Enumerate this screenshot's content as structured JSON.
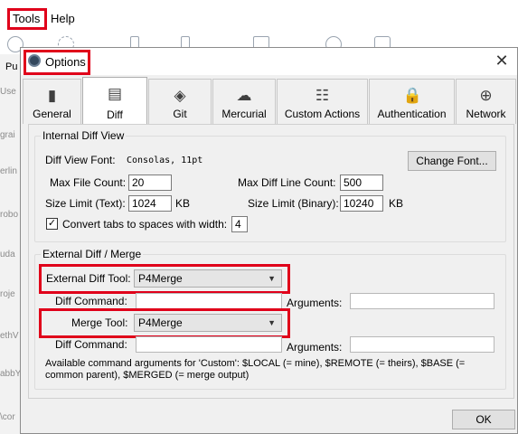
{
  "menubar": {
    "tools_label": "Tools",
    "help_label": "Help"
  },
  "sidebar": {
    "fragments": [
      "Pu",
      "Use",
      "grai",
      "erlin",
      "robo",
      "uda",
      "roje",
      "ethV",
      "abbY",
      "\\cor"
    ]
  },
  "dialog": {
    "title": "Options",
    "close_glyph": "✕",
    "tabs": [
      {
        "label": "General",
        "icon": "general-icon",
        "glyph": "▮"
      },
      {
        "label": "Diff",
        "icon": "diff-icon",
        "glyph": "▤"
      },
      {
        "label": "Git",
        "icon": "git-icon",
        "glyph": "◈"
      },
      {
        "label": "Mercurial",
        "icon": "mercurial-icon",
        "glyph": "☁"
      },
      {
        "label": "Custom Actions",
        "icon": "custom-actions-icon",
        "glyph": "☷"
      },
      {
        "label": "Authentication",
        "icon": "lock-icon",
        "glyph": "🔒"
      },
      {
        "label": "Network",
        "icon": "globe-icon",
        "glyph": "⊕"
      }
    ],
    "active_tab": "Diff",
    "internal": {
      "title": "Internal Diff View",
      "font_label": "Diff View Font:",
      "font_value": "Consolas, 11pt",
      "change_font_button": "Change Font...",
      "max_file_count_label": "Max File Count:",
      "max_file_count": "20",
      "max_line_count_label": "Max Diff Line Count:",
      "max_line_count": "500",
      "size_text_label": "Size Limit (Text):",
      "size_text": "1024",
      "size_text_unit": "KB",
      "size_binary_label": "Size Limit (Binary):",
      "size_binary": "10240",
      "size_binary_unit": "KB",
      "convert_tabs_label": "Convert tabs to spaces with width:",
      "convert_tabs_checked": true,
      "tab_width": "4"
    },
    "external": {
      "title": "External Diff / Merge",
      "diff_tool_label": "External Diff Tool:",
      "diff_tool_value": "P4Merge",
      "diff_command_label": "Diff Command:",
      "diff_command_value": "",
      "diff_arguments_label": "Arguments:",
      "diff_arguments_value": "",
      "merge_tool_label": "Merge Tool:",
      "merge_tool_value": "P4Merge",
      "merge_command_label": "Diff Command:",
      "merge_command_value": "",
      "merge_arguments_label": "Arguments:",
      "merge_arguments_value": "",
      "note": "Available command arguments for 'Custom': $LOCAL (= mine), $REMOTE (= theirs), $BASE (= common parent), $MERGED (= merge output)"
    },
    "ok_button": "OK"
  },
  "colors": {
    "highlight": "#e0001a",
    "dialog_bg": "#f0f0f0"
  }
}
